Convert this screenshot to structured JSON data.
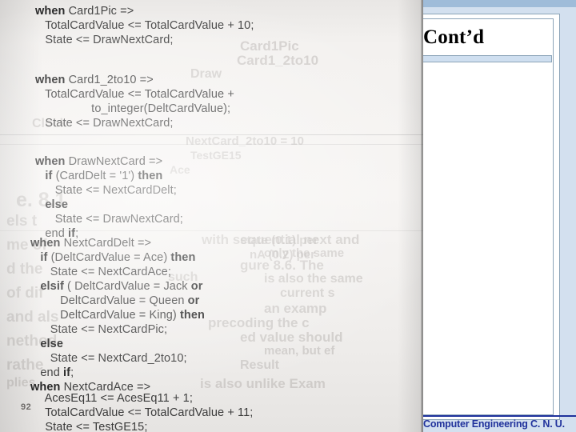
{
  "slide": {
    "title": "Cont’d",
    "footer_text": "Computer Engineering C. N. U.",
    "accent_color": "#20329c",
    "field_color": "#d3e0ef",
    "band_color": "#9fbcd9",
    "rule_color": "#cfdff0"
  },
  "scan": {
    "page_number": "92",
    "code_lines": [
      "when Card1Pic =>",
      "   TotalCardValue <= TotalCardValue + 10;",
      "   State <= DrawNextCard;",
      "when Card1_2to10 =>",
      "   TotalCardValue <= TotalCardValue +",
      "                 to_integer(DeltCardValue);",
      "   State <= DrawNextCard;",
      "when DrawNextCard =>",
      "   if (CardDelt = '1') then",
      "      State <= NextCardDelt;",
      "   else",
      "      State <= DrawNextCard;",
      "   end if;",
      "when NextCardDelt =>",
      "   if (DeltCardValue = Ace) then",
      "      State <= NextCardAce;",
      "   elsif ( DeltCardValue = Jack or",
      "         DeltCardValue = Queen or",
      "         DeltCardValue = King) then",
      "      State <= NextCardPic;",
      "   else",
      "      State <= NextCard_2to10;",
      "   end if;",
      "when NextCardAce =>",
      "   AcesEq11 <= AcesEq11 + 1;",
      "   TotalCardValue <= TotalCardValue + 11;",
      "   State <= TestGE15;"
    ],
    "ghost_fragments": [
      "Card1Pic",
      "Card1_2to10",
      "Draw",
      "Clock",
      "NextCard_2to10  =  10",
      "TestGE15",
      "Ace",
      "e. 8.1",
      "els t",
      "me  of",
      "d the",
      "such",
      "of dif",
      "and als",
      "nethod",
      "rathe",
      "plies",
      "with sequential next and",
      "state (0.1) per",
      "nA (0.2) per",
      "only the same",
      "gure  8.6.  The",
      "is  also the same",
      "current  s",
      "an  examp",
      "precoding the  c",
      "ed value should",
      "mean,  but  ef",
      "Result",
      "is also unlike Exam"
    ]
  }
}
